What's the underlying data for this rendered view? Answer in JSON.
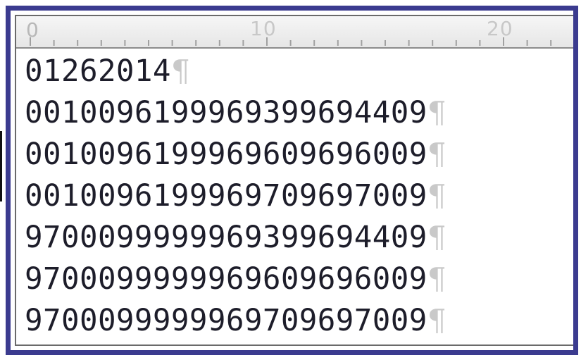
{
  "ruler": {
    "start_label": "0",
    "labels": [
      "10",
      "20"
    ]
  },
  "document": {
    "pilcrow": "¶",
    "lines": [
      "01262014",
      "001009619996939969440 9",
      "0010096199969609696009",
      "0010096199969709697009",
      "9700099999969399694409",
      "9700099999969609696009",
      "9700099999969709697009"
    ]
  }
}
